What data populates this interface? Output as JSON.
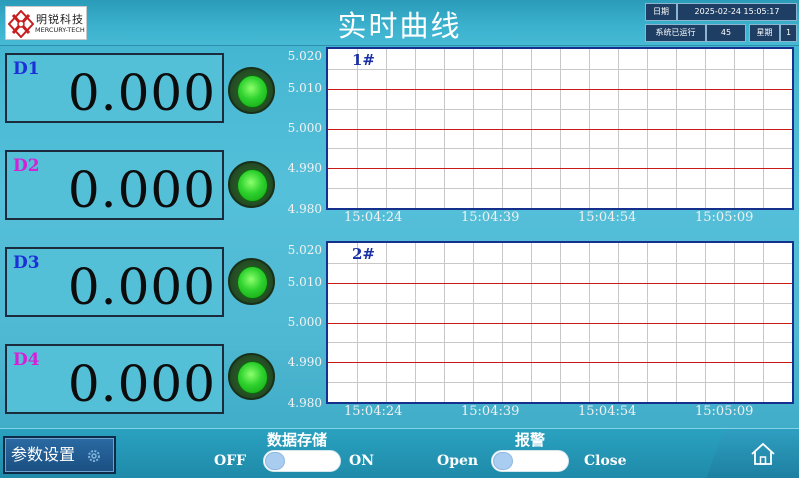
{
  "header": {
    "title": "实时曲线",
    "logo": {
      "cn": "明锐科技",
      "en": "MERCURY-TECH"
    },
    "info": {
      "date_label": "日期",
      "date_value": "2025-02-24 15:05:17",
      "uptime_label": "系统已运行",
      "uptime_value": "45",
      "weekday_label": "星期",
      "weekday_value": "1"
    }
  },
  "displays": [
    {
      "label": "D1",
      "value": "0.000",
      "label_color": "#1d2fd6"
    },
    {
      "label": "D2",
      "value": "0.000",
      "label_color": "#d61fd6"
    },
    {
      "label": "D3",
      "value": "0.000",
      "label_color": "#1d2fd6"
    },
    {
      "label": "D4",
      "value": "0.000",
      "label_color": "#d61fd6"
    }
  ],
  "indicator_color": "#2ed22e",
  "chart_data": [
    {
      "type": "line",
      "title": "1#",
      "y_ticks": [
        "5.020",
        "5.010",
        "5.000",
        "4.990",
        "4.980"
      ],
      "ylim": [
        4.98,
        5.02
      ],
      "x_ticks": [
        "15:04:24",
        "15:04:39",
        "15:04:54",
        "15:05:09"
      ],
      "series": [],
      "grid": true,
      "grid_major_color": "#c81818",
      "grid_minor_color": "#c8c8c8"
    },
    {
      "type": "line",
      "title": "2#",
      "y_ticks": [
        "5.020",
        "5.010",
        "5.000",
        "4.990",
        "4.980"
      ],
      "ylim": [
        4.98,
        5.02
      ],
      "x_ticks": [
        "15:04:24",
        "15:04:39",
        "15:04:54",
        "15:05:09"
      ],
      "series": [],
      "grid": true,
      "grid_major_color": "#c81818",
      "grid_minor_color": "#c8c8c8"
    }
  ],
  "footer": {
    "params_button": "参数设置",
    "storage": {
      "title": "数据存储",
      "off_label": "OFF",
      "on_label": "ON",
      "state": "off"
    },
    "alarm": {
      "title": "报警",
      "open_label": "Open",
      "close_label": "Close",
      "state": "open"
    }
  }
}
